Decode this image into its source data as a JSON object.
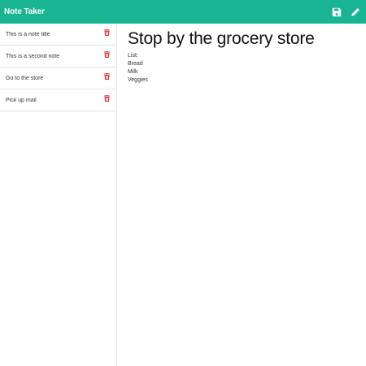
{
  "app": {
    "title": "Note Taker"
  },
  "toolbar": {
    "save_icon": "save-icon",
    "new_icon": "pencil-icon"
  },
  "colors": {
    "brand": "#19b494",
    "delete": "#e0383b"
  },
  "notes": [
    {
      "title": "This is a note title"
    },
    {
      "title": "This is a second note"
    },
    {
      "title": "Go to the store"
    },
    {
      "title": "Pick up mail"
    }
  ],
  "active_note": {
    "title": "Stop by the grocery store",
    "body": "List:\nBread\nMilk\nVeggies"
  }
}
